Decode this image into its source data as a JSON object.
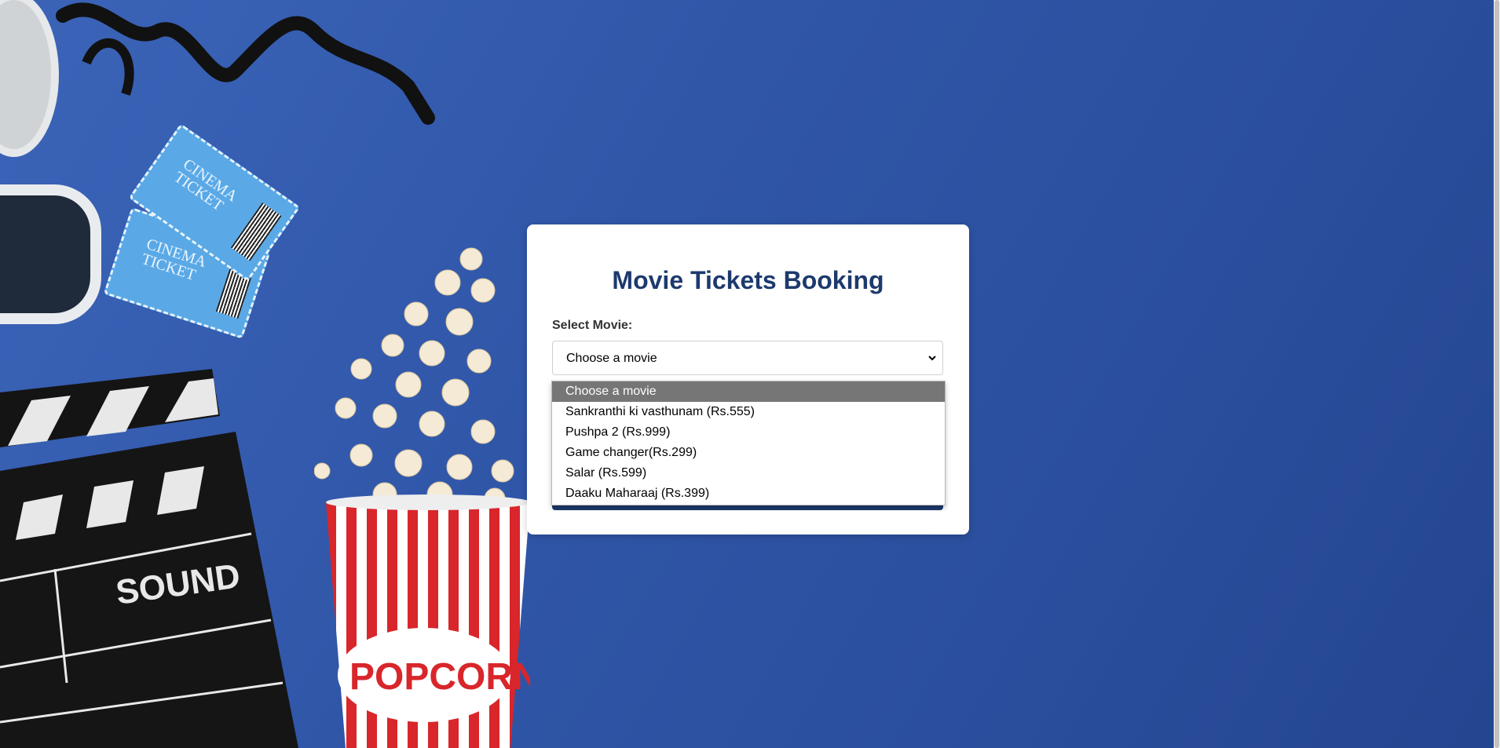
{
  "form": {
    "title": "Movie Tickets Booking",
    "select_label": "Select Movie:",
    "select_value": "Choose a movie"
  },
  "dropdown": {
    "options": [
      "Choose a movie",
      "Sankranthi ki vasthunam (Rs.555)",
      "Pushpa 2 (Rs.999)",
      "Game changer(Rs.299)",
      "Salar (Rs.599)",
      "Daaku Maharaaj (Rs.399)"
    ],
    "selected_index": 0
  },
  "decor": {
    "ticket_text": "CINEMA TICKET",
    "clapper_text": "SOUND",
    "popcorn_text": "POPCORN"
  },
  "colors": {
    "background": "#3056a8",
    "title": "#1d3a6e",
    "selected_option_bg": "#767676",
    "button": "#1d3a6e"
  }
}
